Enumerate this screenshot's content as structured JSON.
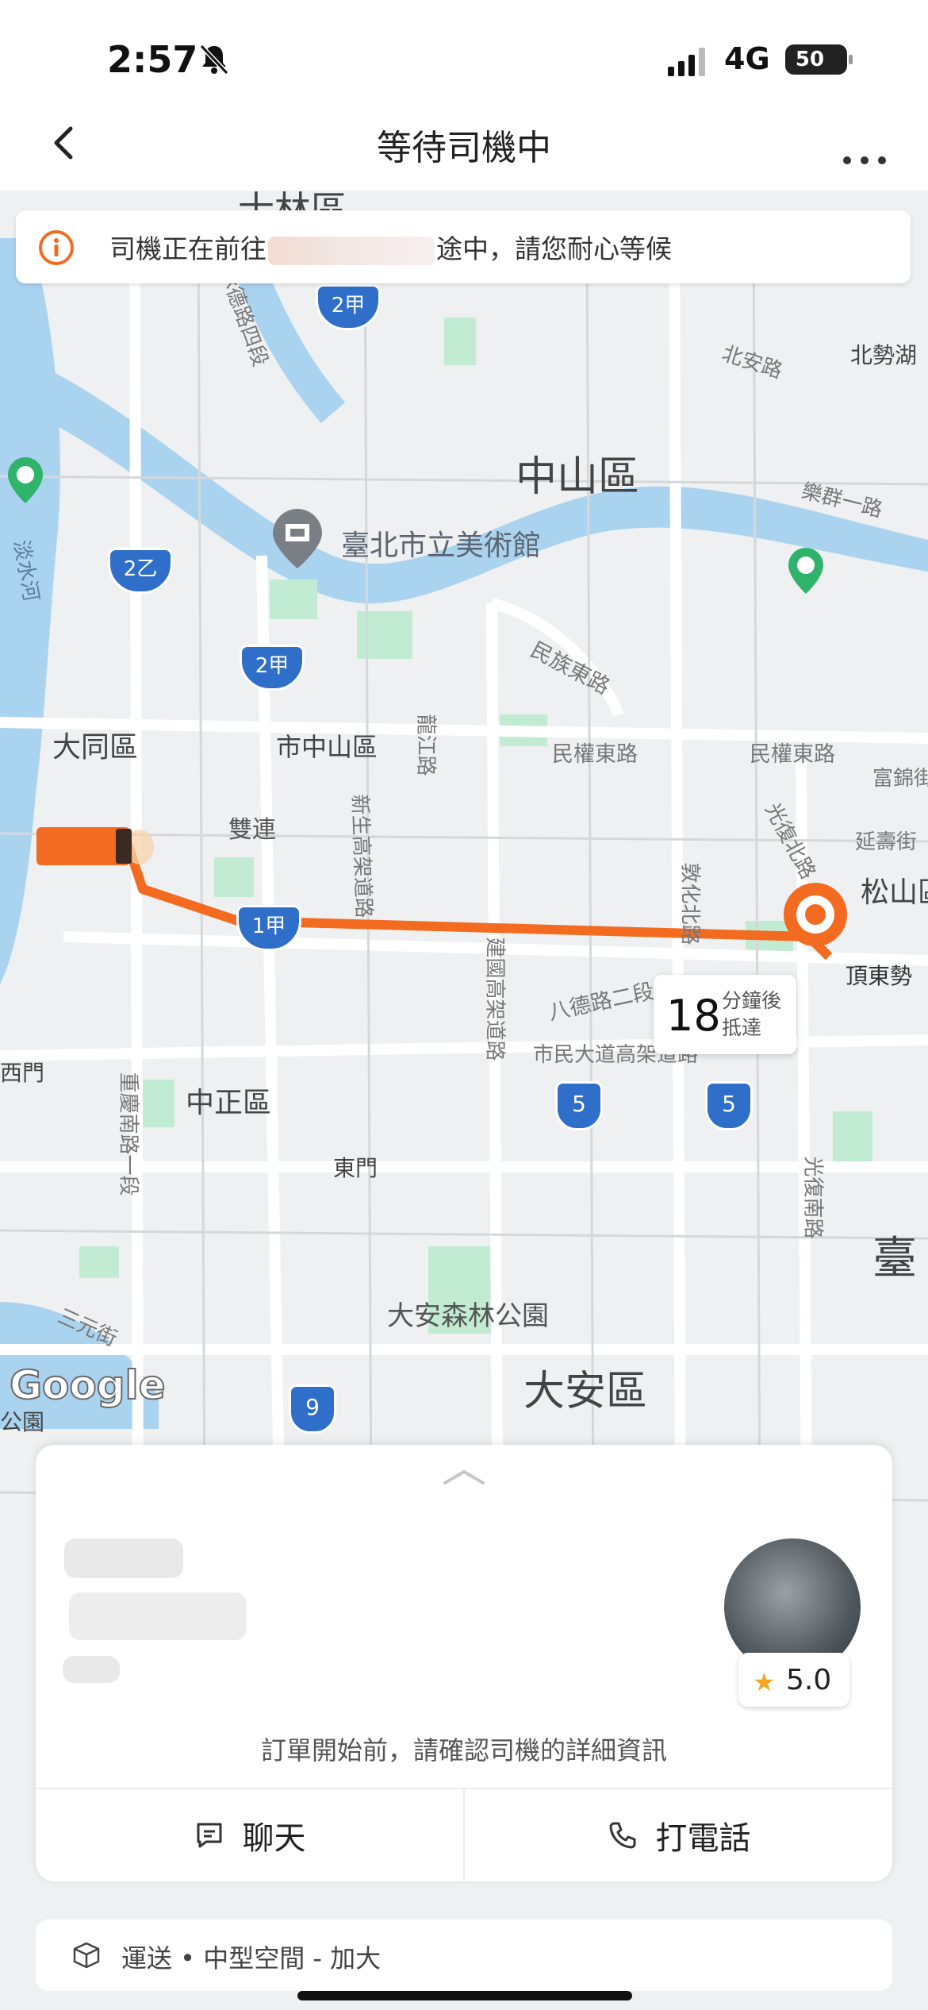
{
  "status_bar": {
    "time": "2:57",
    "network": "4G",
    "battery": "50"
  },
  "header": {
    "title": "等待司機中"
  },
  "notice": {
    "prefix": "司機正在前往",
    "suffix": "途中，請您耐心等候"
  },
  "map": {
    "labels": {
      "shilin": "士林區",
      "zhongshan": "中山區",
      "museum": "臺北市立美術館",
      "datong": "大同區",
      "shizhongshan": "市中山區",
      "shuanglian": "雙連",
      "songshan": "松山區",
      "zhongzheng": "中正區",
      "dongmen": "東門",
      "daan_park": "大安森林公園",
      "daan": "大安區",
      "tai": "臺",
      "beiaolu": "北安路",
      "beishihu": "北勢湖",
      "minzuedong": "民族東路",
      "minquandong_a": "民權東路",
      "minquandong_b": "民權東路",
      "bade": "八德路二段",
      "civic": "市民大道高架道路",
      "dingdongshi": "頂東勢",
      "danshui": "淡水河",
      "lequn": "樂群一路",
      "ximen": "西門",
      "sanyuan": "三元街",
      "guangfu_n": "光復北路",
      "jianguo": "建國高架道路",
      "xinsheng": "新生高架道路",
      "guangfu_s": "光復南路",
      "chongqing": "重慶南路一段",
      "gongyuan": "公園",
      "fujin": "富錦街",
      "yanshou": "延壽街",
      "dunhua": "敦化北路",
      "longjiang": "龍江路",
      "chengde": "承德路四段"
    },
    "route_shields": [
      "2甲",
      "2乙",
      "2甲",
      "1甲",
      "5",
      "5",
      "9"
    ],
    "eta": {
      "minutes": "18",
      "unit_line1": "分鐘後",
      "unit_line2": "抵達"
    },
    "attribution": "Google",
    "colors": {
      "route": "#F26B21",
      "river": "#aad3f0",
      "park": "#c2ebd3"
    }
  },
  "driver_panel": {
    "rating": "5.0",
    "confirm_text": "訂單開始前，請確認司機的詳細資訊",
    "chat_label": "聊天",
    "call_label": "打電話"
  },
  "service": {
    "summary": "運送 • 中型空間 - 加大"
  }
}
